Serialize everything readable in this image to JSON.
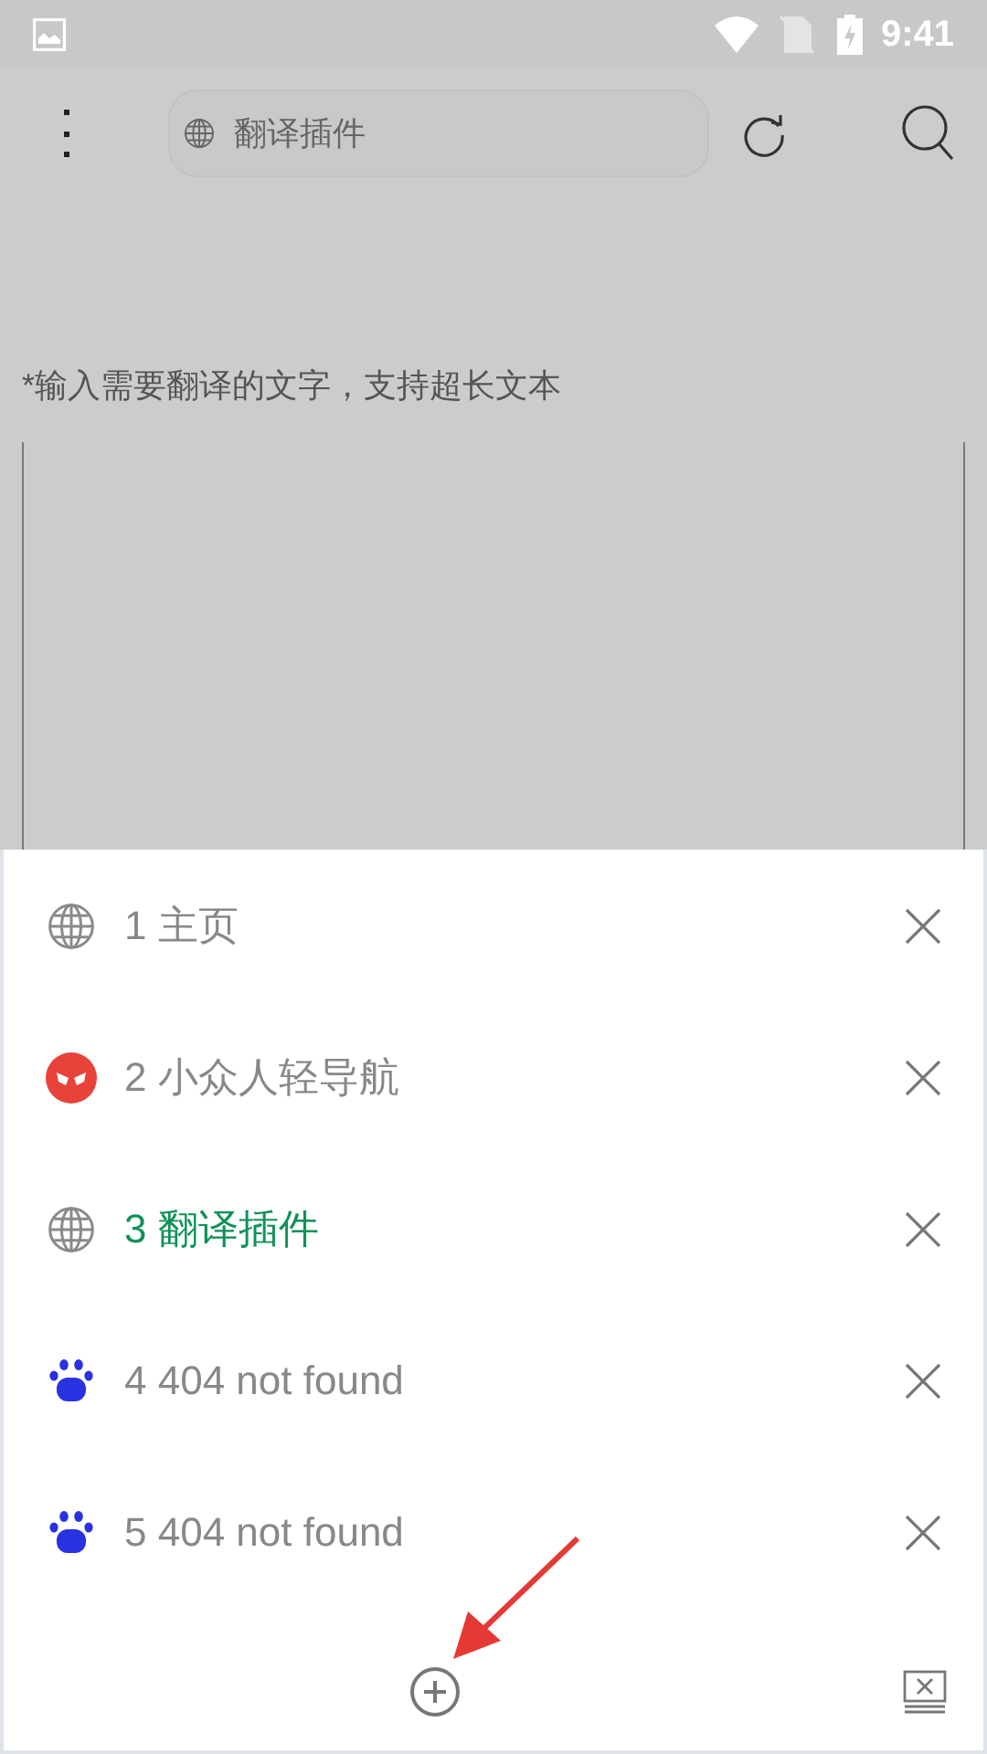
{
  "status_bar": {
    "time": "9:41"
  },
  "toolbar": {
    "address": "翻译插件"
  },
  "hint": "*输入需要翻译的文字，支持超长文本",
  "tabs": [
    {
      "label": "1 主页",
      "kind": "globe",
      "selected": false
    },
    {
      "label": "2 小众人轻导航",
      "kind": "mask",
      "selected": false
    },
    {
      "label": "3 翻译插件",
      "kind": "globe",
      "selected": true
    },
    {
      "label": "4 404 not found",
      "kind": "paw",
      "selected": false
    },
    {
      "label": "5 404 not found",
      "kind": "paw",
      "selected": false
    }
  ]
}
